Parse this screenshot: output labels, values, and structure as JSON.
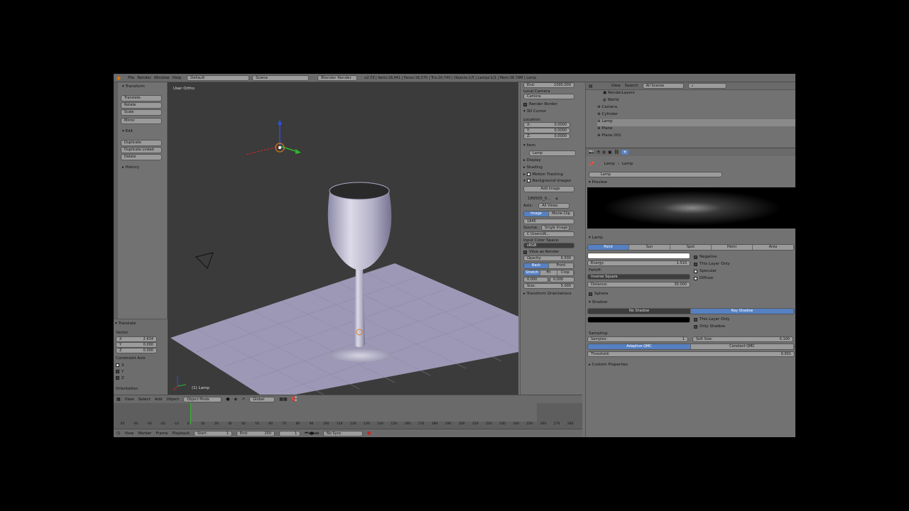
{
  "topbar": {
    "menus": [
      "File",
      "Render",
      "Window",
      "Help"
    ],
    "layout": "Default",
    "scene": "Scene",
    "engine": "Blender Render",
    "stats": "v2.73 | Verts:18,441 | Faces:18,370 | Tris:20,740 | Objects:1/5 | Lamps:1/1 | Mem:36.79M | Lamp"
  },
  "toolshelf": {
    "transform_header": "Transform",
    "transform_buttons": [
      "Translate",
      "Rotate",
      "Scale"
    ],
    "mirror": "Mirror",
    "edit_header": "Edit",
    "edit_buttons": [
      "Duplicate",
      "Duplicate Linked",
      "Delete"
    ],
    "history_header": "History",
    "op_header": "Translate",
    "vector_label": "Vector",
    "vector": [
      {
        "axis": "X",
        "value": "2.634"
      },
      {
        "axis": "Y",
        "value": "0.000"
      },
      {
        "axis": "Z",
        "value": "0.000"
      }
    ],
    "constraint_label": "Constraint Axis",
    "constraint_axes": [
      "X",
      "Y",
      "Z"
    ],
    "orientation_label": "Orientation"
  },
  "viewport": {
    "view_label": "User Ortho",
    "object_label": "(1) Lamp"
  },
  "nprops": {
    "clip_end_label": "End:",
    "clip_end_value": "1000.000",
    "local_camera": "Local Camera",
    "camera_field": "Camera",
    "render_border": "Render Border",
    "cursor_header": "3D Cursor",
    "location_label": "Location:",
    "cursor": [
      {
        "axis": "X:",
        "value": "0.0000"
      },
      {
        "axis": "Y:",
        "value": "0.0000"
      },
      {
        "axis": "Z:",
        "value": "0.0000"
      }
    ],
    "item_header": "Item",
    "item_name": "Lamp",
    "display": "Display",
    "shading": "Shading",
    "motion_tracking": "Motion Tracking",
    "background_images": "Background Images",
    "add_image": "Add Image",
    "image_name": "189505_0...",
    "axis_label": "Axis:",
    "axis_value": "All Views",
    "image_tab": "Image",
    "movie_clip_tab": "Movie Clip",
    "image_id": "1845",
    "source_label": "Source:",
    "source_value": "Single Image",
    "file_path": "C:\\Users\\Al...",
    "input_color_space": "Input Color Space:",
    "color_space": "sRGB",
    "view_as_render": "View as Render",
    "opacity_label": "Opacity:",
    "opacity_value": "0.500",
    "back": "Back",
    "front": "Front",
    "stretch": "Stretch",
    "fit": "Fit",
    "crop": "Crop",
    "offset_x": "0.000",
    "offset_y": "0.000",
    "size_label": "Size:",
    "size_value": "5.000",
    "transform_orientations": "Transform Orientations"
  },
  "outliner": {
    "view": "View",
    "search": "Search",
    "scenes": "All Scenes",
    "items": [
      "RenderLayers",
      "World",
      "Camera",
      "Cylinder",
      "Lamp",
      "Plane",
      "Plane.001"
    ]
  },
  "properties": {
    "breadcrumb_lamp1": "Lamp",
    "breadcrumb_lamp2": "Lamp",
    "datablock": "Lamp",
    "preview_header": "Preview",
    "lamp_header": "Lamp",
    "lamp_types": [
      "Point",
      "Sun",
      "Spot",
      "Hemi",
      "Area"
    ],
    "energy_label": "Energy:",
    "energy_value": "1.510",
    "falloff_label": "Falloff:",
    "falloff_value": "Inverse Square",
    "distance_label": "Distance:",
    "distance_value": "30.000",
    "sphere": "Sphere",
    "negative": "Negative",
    "this_layer_only": "This Layer Only",
    "specular": "Specular",
    "diffuse": "Diffuse",
    "shadow_header": "Shadow",
    "no_shadow": "No Shadow",
    "ray_shadow": "Ray Shadow",
    "shadow_this_layer": "This Layer Only",
    "only_shadow": "Only Shadow",
    "sampling_label": "Sampling:",
    "samples_label": "Samples:",
    "samples_value": "1",
    "soft_size_label": "Soft Size:",
    "soft_size_value": "0.100",
    "adaptive_qmc": "Adaptive QMC",
    "constant_qmc": "Constant QMC",
    "threshold_label": "Threshold:",
    "threshold_value": "0.001",
    "custom_properties": "Custom Properties"
  },
  "viewheader": {
    "menus": [
      "View",
      "Select",
      "Add",
      "Object"
    ],
    "mode": "Object Mode",
    "orientation": "Global"
  },
  "timeline": {
    "ticks": [
      "-50",
      "-40",
      "-30",
      "-20",
      "-10",
      "0",
      "10",
      "20",
      "30",
      "40",
      "50",
      "60",
      "70",
      "80",
      "90",
      "100",
      "110",
      "120",
      "130",
      "140",
      "150",
      "160",
      "170",
      "180",
      "190",
      "200",
      "210",
      "220",
      "230",
      "240",
      "250",
      "260",
      "270",
      "280"
    ],
    "menus": [
      "View",
      "Marker",
      "Frame",
      "Playback"
    ],
    "start_label": "Start:",
    "start_value": "1",
    "end_label": "End:",
    "end_value": "250",
    "current_frame": "1",
    "sync": "No Sync"
  }
}
